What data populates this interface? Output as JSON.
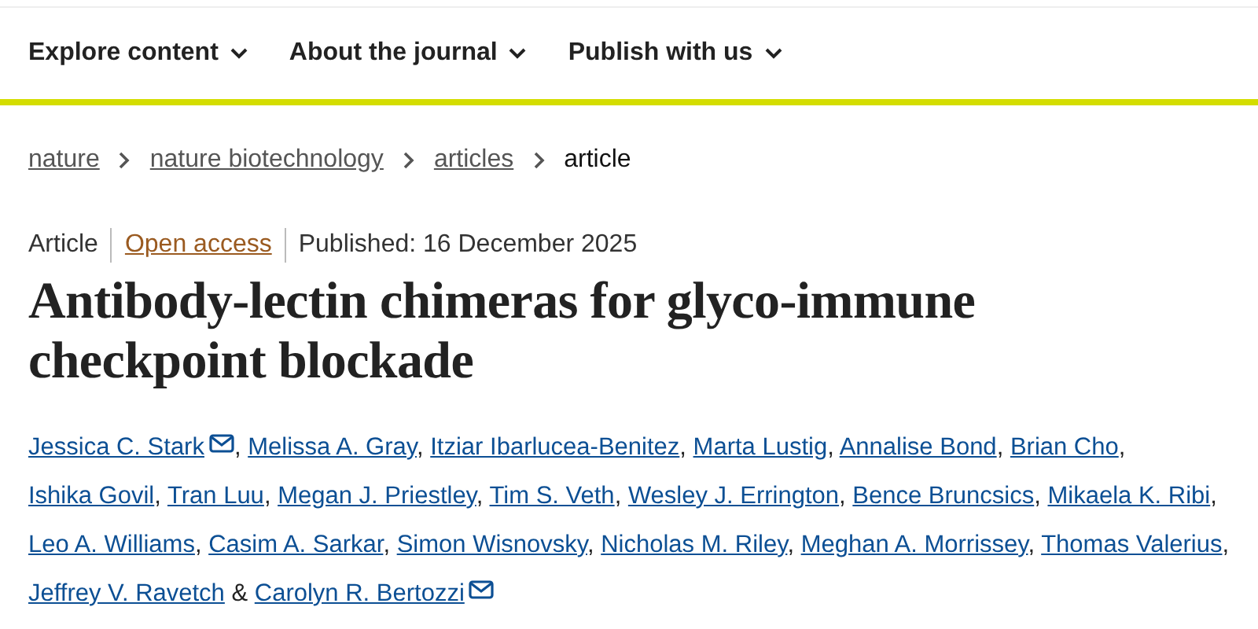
{
  "nav": [
    {
      "label": "Explore content"
    },
    {
      "label": "About the journal"
    },
    {
      "label": "Publish with us"
    }
  ],
  "breadcrumb": [
    {
      "label": "nature",
      "link": true
    },
    {
      "label": "nature biotechnology",
      "link": true
    },
    {
      "label": "articles",
      "link": true
    },
    {
      "label": "article",
      "link": false
    }
  ],
  "meta": {
    "type": "Article",
    "access": "Open access",
    "published": "Published: 16 December 2025"
  },
  "title": "Antibody-lectin chimeras for glyco-immune checkpoint blockade",
  "authors": [
    {
      "name": "Jessica C. Stark",
      "email": true,
      "sep": ","
    },
    {
      "name": "Melissa A. Gray",
      "email": false,
      "sep": ","
    },
    {
      "name": "Itziar Ibarlucea-Benitez",
      "email": false,
      "sep": ","
    },
    {
      "name": "Marta Lustig",
      "email": false,
      "sep": ","
    },
    {
      "name": "Annalise Bond",
      "email": false,
      "sep": ","
    },
    {
      "name": "Brian Cho",
      "email": false,
      "sep": ","
    },
    {
      "name": "Ishika Govil",
      "email": false,
      "sep": ","
    },
    {
      "name": "Tran Luu",
      "email": false,
      "sep": ","
    },
    {
      "name": "Megan J. Priestley",
      "email": false,
      "sep": ","
    },
    {
      "name": "Tim S. Veth",
      "email": false,
      "sep": ","
    },
    {
      "name": "Wesley J. Errington",
      "email": false,
      "sep": ","
    },
    {
      "name": "Bence Bruncsics",
      "email": false,
      "sep": ","
    },
    {
      "name": "Mikaela K. Ribi",
      "email": false,
      "sep": ","
    },
    {
      "name": "Leo A. Williams",
      "email": false,
      "sep": ","
    },
    {
      "name": "Casim A. Sarkar",
      "email": false,
      "sep": ","
    },
    {
      "name": "Simon Wisnovsky",
      "email": false,
      "sep": ","
    },
    {
      "name": "Nicholas M. Riley",
      "email": false,
      "sep": ","
    },
    {
      "name": "Meghan A. Morrissey",
      "email": false,
      "sep": ","
    },
    {
      "name": "Thomas Valerius",
      "email": false,
      "sep": ","
    },
    {
      "name": "Jeffrey V. Ravetch",
      "email": false,
      "sep": " &"
    },
    {
      "name": "Carolyn R. Bertozzi",
      "email": true
    }
  ]
}
